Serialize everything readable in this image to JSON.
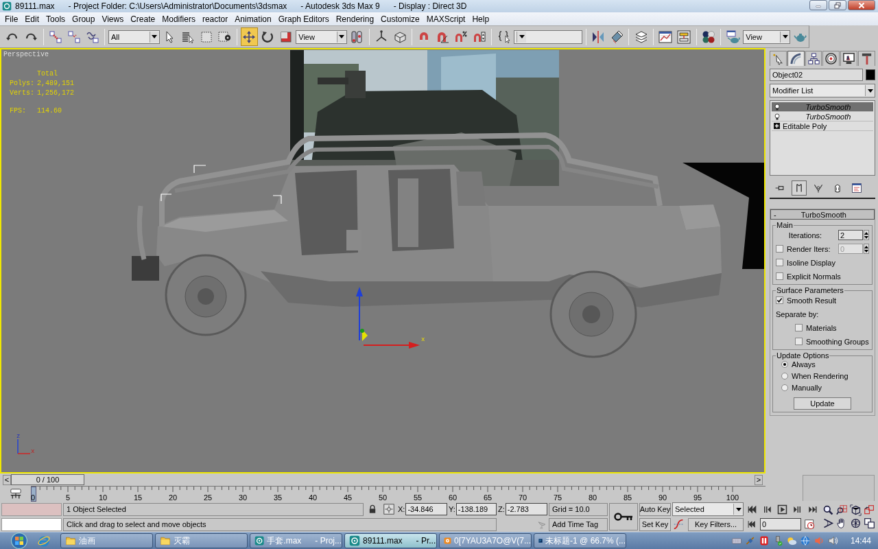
{
  "window": {
    "title": "89111.max      - Project Folder: C:\\Users\\Administrator\\Documents\\3dsmax      - Autodesk 3ds Max 9      - Display : Direct 3D"
  },
  "menu": [
    "File",
    "Edit",
    "Tools",
    "Group",
    "Views",
    "Create",
    "Modifiers",
    "reactor",
    "Animation",
    "Graph Editors",
    "Rendering",
    "Customize",
    "MAXScript",
    "Help"
  ],
  "toolbar": [
    {
      "kind": "button",
      "selected": false
    },
    {
      "kind": "button",
      "selected": false
    },
    {
      "kind": "separator"
    },
    {
      "kind": "button",
      "selected": false
    },
    {
      "kind": "button",
      "selected": false
    },
    {
      "kind": "button",
      "selected": false
    },
    {
      "kind": "separator"
    },
    {
      "kind": "dropdown",
      "value": "All"
    },
    {
      "kind": "button",
      "selected": false
    },
    {
      "kind": "button",
      "selected": false
    },
    {
      "kind": "button",
      "selected": false
    },
    {
      "kind": "button",
      "selected": false
    },
    {
      "kind": "separator"
    },
    {
      "kind": "button",
      "selected": true
    },
    {
      "kind": "button",
      "selected": false
    },
    {
      "kind": "button",
      "selected": false
    },
    {
      "kind": "dropdown",
      "value": "View"
    },
    {
      "kind": "button",
      "selected": false
    },
    {
      "kind": "separator"
    },
    {
      "kind": "button",
      "selected": false
    },
    {
      "kind": "button",
      "selected": false
    },
    {
      "kind": "separator"
    },
    {
      "kind": "button",
      "selected": false
    },
    {
      "kind": "button",
      "selected": false
    },
    {
      "kind": "button",
      "selected": false
    },
    {
      "kind": "button",
      "selected": false
    },
    {
      "kind": "separator"
    },
    {
      "kind": "button",
      "selected": false
    },
    {
      "kind": "dropdown"
    },
    {
      "kind": "separator"
    },
    {
      "kind": "button",
      "selected": false
    },
    {
      "kind": "button",
      "selected": false
    },
    {
      "kind": "separator"
    },
    {
      "kind": "button",
      "selected": false
    },
    {
      "kind": "separator"
    },
    {
      "kind": "button",
      "selected": false
    },
    {
      "kind": "button",
      "selected": false
    },
    {
      "kind": "separator"
    },
    {
      "kind": "button",
      "selected": false
    },
    {
      "kind": "separator"
    },
    {
      "kind": "button",
      "selected": false
    },
    {
      "kind": "dropdown",
      "value": "View"
    },
    {
      "kind": "button",
      "selected": false
    }
  ],
  "viewport": {
    "label": "Perspective",
    "stats_heading": "Total",
    "stats": [
      {
        "label": "Polys:",
        "value": "2,489,151"
      },
      {
        "label": "Verts:",
        "value": "1,256,172"
      },
      {
        "label": "FPS:",
        "value": "114.60"
      }
    ],
    "gizmo_label": "x",
    "tripod_labels": [
      "z",
      "x"
    ]
  },
  "command_panel": {
    "tabs": [
      {
        "selected": false
      },
      {
        "selected": true
      },
      {
        "selected": false
      },
      {
        "selected": false
      },
      {
        "selected": false
      },
      {
        "selected": false
      }
    ],
    "object_name": "Object02",
    "modifier_list": "Modifier List",
    "stack": [
      {
        "kind": "modifier",
        "label": "TurboSmooth",
        "selected": true
      },
      {
        "kind": "modifier",
        "label": "TurboSmooth",
        "selected": false
      },
      {
        "kind": "base",
        "label": "Editable Poly",
        "selected": false,
        "expanded": false
      }
    ],
    "stack_buttons": [
      {
        "selected": false
      },
      {
        "selected": true
      },
      {
        "selected": false
      },
      {
        "selected": false
      },
      {
        "selected": false
      }
    ],
    "rollout": {
      "toggle": "-",
      "title": "TurboSmooth",
      "groups": [
        {
          "title": "Main",
          "items": [
            {
              "kind": "spinner",
              "label": "Iterations:",
              "value": "2"
            },
            {
              "kind": "check_spinner",
              "label": "Render Iters:",
              "value": "0",
              "checked": false,
              "disabled": true
            },
            {
              "kind": "checkbox",
              "label": "Isoline Display",
              "checked": false
            },
            {
              "kind": "checkbox",
              "label": "Explicit Normals",
              "checked": false
            }
          ]
        },
        {
          "title": "Surface Parameters",
          "items": [
            {
              "kind": "checkbox",
              "label": "Smooth Result",
              "checked": true
            },
            {
              "kind": "text",
              "label": "Separate by:"
            },
            {
              "kind": "sub_checkbox",
              "label": "Materials",
              "checked": false
            },
            {
              "kind": "sub_checkbox",
              "label": "Smoothing Groups",
              "checked": false
            }
          ]
        },
        {
          "title": "Update Options",
          "items": [
            {
              "kind": "radio",
              "label": "Always",
              "selected": true
            },
            {
              "kind": "radio",
              "label": "When Rendering",
              "selected": false
            },
            {
              "kind": "radio",
              "label": "Manually",
              "selected": false
            },
            {
              "kind": "button",
              "label": "Update"
            }
          ]
        }
      ]
    }
  },
  "timeline": {
    "prev": "<",
    "next": ">",
    "slider": {
      "label": "0 / 100",
      "level": 0
    },
    "ticks": [
      "0",
      "5",
      "10",
      "15",
      "20",
      "25",
      "30",
      "35",
      "40",
      "45",
      "50",
      "55",
      "60",
      "65",
      "70",
      "75",
      "80",
      "85",
      "90",
      "95",
      "100"
    ]
  },
  "status": {
    "selection": "1 Object Selected",
    "prompt": "Click and drag to select and move objects",
    "coords": [
      {
        "label": "X:",
        "value": "-34.846"
      },
      {
        "label": "Y:",
        "value": "-138.189"
      },
      {
        "label": "Z:",
        "value": "-2.783"
      }
    ],
    "grid": "Grid = 10.0",
    "time_tag": "Add Time Tag"
  },
  "animation": {
    "auto_key": "Auto Key",
    "set_key": "Set Key",
    "key_set": "Selected",
    "key_filters": "Key Filters...",
    "frame": "0"
  },
  "taskbar": {
    "tasks": [
      {
        "kind": "folder",
        "label": "油画",
        "selected": false
      },
      {
        "kind": "folder",
        "label": "灭霸",
        "selected": false
      },
      {
        "kind": "max",
        "label": "手套.max      - Proj...",
        "selected": false
      },
      {
        "kind": "max",
        "label": "89111.max      - Pr...",
        "selected": true
      },
      {
        "kind": "qq",
        "label": "0[7YAU3A7O@V(7...",
        "selected": false
      },
      {
        "kind": "ps",
        "label": "未标题-1 @ 66.7% (...",
        "selected": false
      }
    ],
    "clock": "14:44"
  }
}
